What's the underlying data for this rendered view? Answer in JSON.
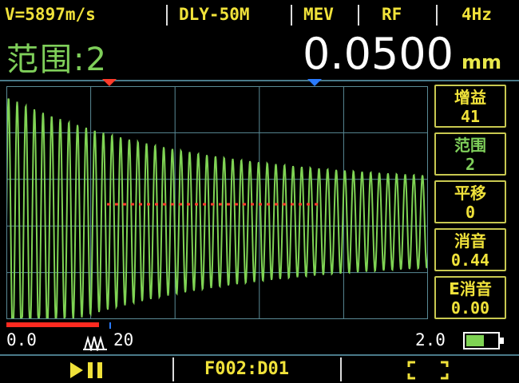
{
  "topbar": {
    "velocity": "V=5897m/s",
    "delay": "DLY-50M",
    "mode": "MEV",
    "wave": "RF",
    "frequency": "4Hz"
  },
  "header": {
    "range_label": "范围:2",
    "reading": "0.0500",
    "unit": "mm"
  },
  "sidebar": {
    "items": [
      {
        "title": "增益",
        "value": "41"
      },
      {
        "title": "范围",
        "value": "2"
      },
      {
        "title": "平移",
        "value": "0"
      },
      {
        "title": "消音",
        "value": "0.44"
      },
      {
        "title": "E消音",
        "value": "0.00"
      }
    ],
    "active_index": 1
  },
  "axis": {
    "start": "0.0",
    "end": "2.0"
  },
  "bottombar": {
    "file": "F002:D01"
  },
  "icons": {
    "play_pause": "play-pause-icon",
    "fullscreen": "fullscreen-icon",
    "battery": "battery-icon",
    "peak": "peak-marker-icon",
    "gate_marker": "gate-marker-icon",
    "zero_marker": "zero-marker-icon"
  },
  "colors": {
    "signal": "#7fd354",
    "label_yellow": "#f0e23a",
    "label_green": "#7fcf5a",
    "grid": "#5a8a96",
    "gate": "#ff3b2a",
    "marker_blue": "#2a7bff"
  }
}
